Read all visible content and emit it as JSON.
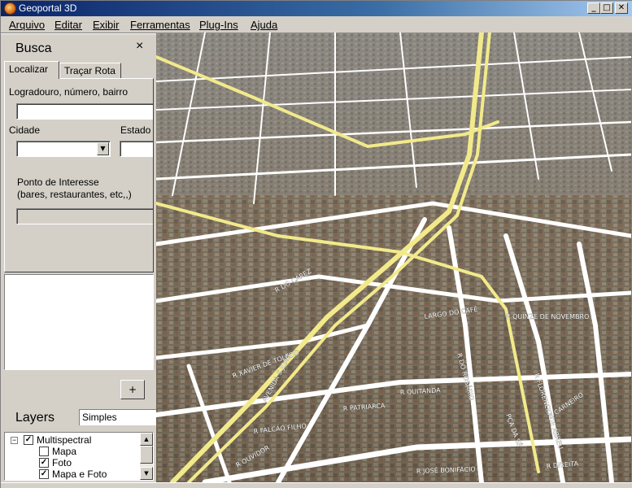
{
  "window": {
    "title": "Geoportal 3D",
    "min_glyph": "_",
    "max_glyph": "□",
    "close_glyph": "✕"
  },
  "menu": {
    "items": [
      "Arquivo",
      "Editar",
      "Exibir",
      "Ferramentas",
      "Plug-Ins",
      "Ajuda"
    ]
  },
  "busca": {
    "title": "Busca",
    "close_glyph": "×",
    "tabs": [
      "Localizar",
      "Traçar Rota"
    ],
    "logradouro_label": "Logradouro, número, bairro",
    "logradouro_value": "",
    "cidade_label": "Cidade",
    "cidade_value": "",
    "estado_label": "Estado",
    "estado_value": "",
    "poi_label_line1": "Ponto de Interesse",
    "poi_label_line2": "(bares, restaurantes, etc,,)",
    "poi_value": "",
    "add_button": "+"
  },
  "layers": {
    "title": "Layers",
    "mode": "Simples",
    "tree": [
      {
        "label": "Multispectral",
        "checked": true,
        "expander": "−"
      },
      {
        "label": "Mapa",
        "checked": false
      },
      {
        "label": "Foto",
        "checked": true
      },
      {
        "label": "Mapa e Foto",
        "checked": true
      }
    ]
  },
  "map": {
    "streets": [
      "LARGO DO CAFÉ",
      "R QUINZE DE NOVEMBRO",
      "R QUITANDA",
      "R DO ROSÁRIO",
      "R FALCÃO FILHO",
      "R JOSÉ BONIFÁCIO",
      "R DIREITA",
      "R PATRIARCA",
      "PÇA DA SÉ",
      "R CARNEIRO",
      "R DO CAREZ",
      "AVENIDA S JOÃO",
      "R FLORENCIO DE ABREU",
      "R OUVIDOR",
      "R XAVIER DE TOLEDO"
    ],
    "colors": {
      "street": "#ffffff",
      "highway": "#f2ea8a",
      "ground": "#7a6a55"
    }
  }
}
